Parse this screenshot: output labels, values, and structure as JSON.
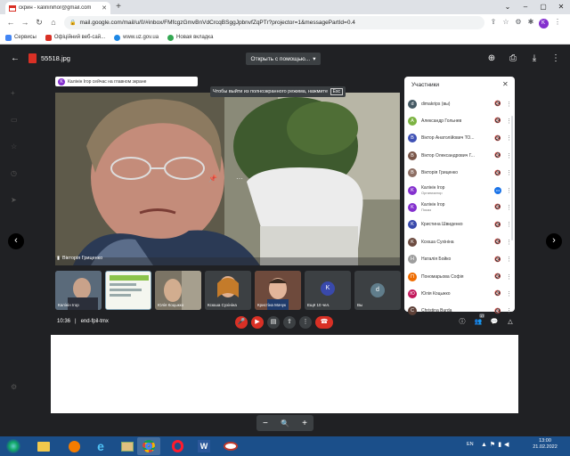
{
  "browser": {
    "tab_title": "скрин - kalininihor@gmail.com",
    "url": "mail.google.com/mail/u/0/#inbox/FMfcgzGmvBnVdCrcqBSggJpbnvfZqPTr?projector=1&messagePartId=0.4",
    "profile_initial": "K",
    "bookmarks": [
      "Сервисы",
      "Офіційний веб-сай...",
      "www.uz.gov.ua",
      "Новая вкладка"
    ]
  },
  "viewer": {
    "file_name": "55518.jpg",
    "open_with": "Открыть с помощью..."
  },
  "meet": {
    "presenting_notice": "Калінін Ігор сейчас на главном экране",
    "presenter_initial": "K",
    "fullscreen_hint": "Чтобы выйти из полноэкранного режима, нажмите",
    "esc_key": "Esc",
    "main_video_label": "Вікторія Гриценко",
    "time": "10:36",
    "meeting_code": "end-fpil-tmx",
    "thumbnails": [
      {
        "label": "Калінін Ігор"
      },
      {
        "label": ""
      },
      {
        "label": "Юлія Коцьжко"
      },
      {
        "label": "Ксюша Сухініна"
      },
      {
        "label": "Кристіна Мачук"
      },
      {
        "label": "Ещё 10 чел.",
        "initial": "K"
      },
      {
        "label": "Вы",
        "initial": "d"
      }
    ],
    "participant_count": "17"
  },
  "participants": {
    "title": "Участники",
    "people": [
      {
        "name": "dimakrips (вы)",
        "initial": "d",
        "color": "#455a64"
      },
      {
        "name": "Александр Гольнев",
        "initial": "A",
        "color": "#7cb342"
      },
      {
        "name": "Віктор Анатолійович ТО...",
        "initial": "B",
        "color": "#3f51b5"
      },
      {
        "name": "Віктор Олександрович Г...",
        "initial": "В",
        "color": "#795548"
      },
      {
        "name": "Вікторія Гриценко",
        "initial": "В",
        "color": "#8d6e63"
      },
      {
        "name": "Калінін Ігор",
        "sub": "Организатор",
        "initial": "K",
        "color": "#8430ce"
      },
      {
        "name": "Калінін Ігор",
        "sub": "Показ",
        "initial": "K",
        "color": "#8430ce"
      },
      {
        "name": "Кристина Швиденко",
        "initial": "K",
        "color": "#3949ab"
      },
      {
        "name": "Ксюша Сухініна",
        "initial": "K",
        "color": "#6d4c41"
      },
      {
        "name": "Наталія Бойко",
        "initial": "Н",
        "color": "#9e9e9e"
      },
      {
        "name": "Пономарьова Софія",
        "initial": "П",
        "color": "#ef6c00"
      },
      {
        "name": "Юлія Коцьжко",
        "initial": "Ю",
        "color": "#c2185b"
      },
      {
        "name": "Christina Burda",
        "initial": "C",
        "color": "#5d4037"
      }
    ]
  },
  "taskbar": {
    "lang": "EN",
    "time": "13:00",
    "date": "21.02.2022"
  }
}
